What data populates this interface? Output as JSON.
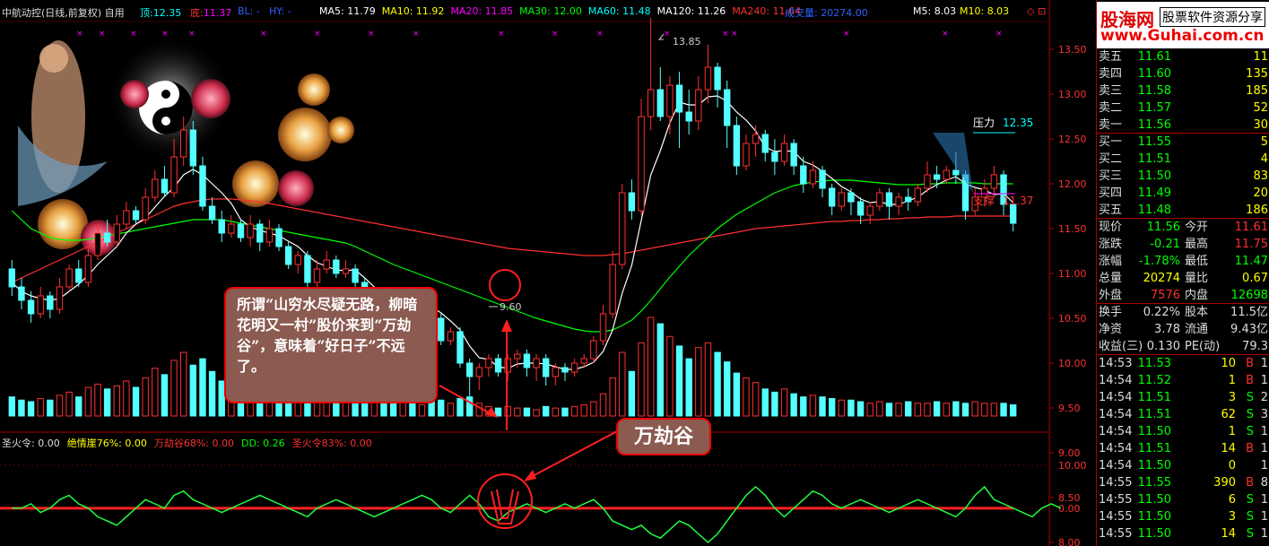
{
  "header": {
    "title": "中航动控(日线,前复权) 自用",
    "top_label": "顶:",
    "top_val": "12.35",
    "bot_label": "底:",
    "bot_val": "11.37",
    "bl": "BL: -",
    "hy": "HY: -",
    "ma": [
      {
        "label": "MA5: 11.79",
        "color": "#ffffff"
      },
      {
        "label": "MA10: 11.92",
        "color": "#ffff00"
      },
      {
        "label": "MA20: 11.85",
        "color": "#ff00ff"
      },
      {
        "label": "MA30: 12.00",
        "color": "#00ff00"
      },
      {
        "label": "MA60: 11.48",
        "color": "#00ffff"
      },
      {
        "label": "MA120: 11.26",
        "color": "#ffffff"
      },
      {
        "label": "MA240: 11.64",
        "color": "#ff3030"
      }
    ],
    "vol": "成交量: 20274.00",
    "m5": "M5: 8.03",
    "m10": "M10: 8.03"
  },
  "indicator_header": [
    {
      "label": "圣火令: 0.00",
      "color": "#dddddd"
    },
    {
      "label": "绝情崖76%: 0.00",
      "color": "#ffff00"
    },
    {
      "label": "万劫谷68%: 0.00",
      "color": "#ff3030"
    },
    {
      "label": "DD: 0.26",
      "color": "#00ff00"
    },
    {
      "label": "圣火令83%: 0.00",
      "color": "#ff3030"
    }
  ],
  "callout_text": "所谓“山穷水尽疑无路，柳暗花明又一村”股价来到“万劫谷”，意味着“好日子”不远了。",
  "badge_text": "万劫谷",
  "annotations": {
    "high": "13.85",
    "low": "9.60",
    "pressure": "压力",
    "pressure_val": "12.35",
    "support": "支撑",
    "support_val": "11.37"
  },
  "logo": {
    "line1": "股海网",
    "line2": "股票软件资源分享",
    "line3": "www.Guhai.com.cn"
  },
  "orderbook": [
    {
      "label": "卖五",
      "price": "11.61",
      "vol": "11"
    },
    {
      "label": "卖四",
      "price": "11.60",
      "vol": "135"
    },
    {
      "label": "卖三",
      "price": "11.58",
      "vol": "185"
    },
    {
      "label": "卖二",
      "price": "11.57",
      "vol": "52"
    },
    {
      "label": "卖一",
      "price": "11.56",
      "vol": "30"
    },
    {
      "label": "买一",
      "price": "11.55",
      "vol": "5"
    },
    {
      "label": "买二",
      "price": "11.51",
      "vol": "4"
    },
    {
      "label": "买三",
      "price": "11.50",
      "vol": "83"
    },
    {
      "label": "买四",
      "price": "11.49",
      "vol": "20"
    },
    {
      "label": "买五",
      "price": "11.48",
      "vol": "186"
    }
  ],
  "stats": [
    {
      "l1": "现价",
      "v1": "11.56",
      "c1": "#00ff00",
      "l2": "今开",
      "v2": "11.61",
      "c2": "#ff3030"
    },
    {
      "l1": "涨跌",
      "v1": "-0.21",
      "c1": "#00ff00",
      "l2": "最高",
      "v2": "11.75",
      "c2": "#ff3030"
    },
    {
      "l1": "涨幅",
      "v1": "-1.78%",
      "c1": "#00ff00",
      "l2": "最低",
      "v2": "11.47",
      "c2": "#00ff00"
    },
    {
      "l1": "总量",
      "v1": "20274",
      "c1": "#ffff00",
      "l2": "量比",
      "v2": "0.67",
      "c2": "#ffff00"
    },
    {
      "l1": "外盘",
      "v1": "7576",
      "c1": "#ff3030",
      "l2": "内盘",
      "v2": "12698",
      "c2": "#00ff00"
    }
  ],
  "stats2": [
    {
      "l1": "换手",
      "v1": "0.22%",
      "l2": "股本",
      "v2": "11.5亿"
    },
    {
      "l1": "净资",
      "v1": "3.78",
      "l2": "流通",
      "v2": "9.43亿"
    },
    {
      "l1": "收益(三)",
      "v1": "0.130",
      "l2": "PE(动)",
      "v2": "79.3"
    }
  ],
  "ticks": [
    {
      "t": "14:53",
      "p": "11.53",
      "v": "10",
      "s": "B",
      "n": "1"
    },
    {
      "t": "14:54",
      "p": "11.52",
      "v": "1",
      "s": "B",
      "n": "1"
    },
    {
      "t": "14:54",
      "p": "11.51",
      "v": "3",
      "s": "S",
      "n": "2"
    },
    {
      "t": "14:54",
      "p": "11.51",
      "v": "62",
      "s": "S",
      "n": "3"
    },
    {
      "t": "14:54",
      "p": "11.50",
      "v": "1",
      "s": "S",
      "n": "1"
    },
    {
      "t": "14:54",
      "p": "11.51",
      "v": "14",
      "s": "B",
      "n": "1"
    },
    {
      "t": "14:54",
      "p": "11.50",
      "v": "0",
      "s": "",
      "n": "1"
    },
    {
      "t": "14:55",
      "p": "11.55",
      "v": "390",
      "s": "B",
      "n": "8"
    },
    {
      "t": "14:55",
      "p": "11.50",
      "v": "6",
      "s": "S",
      "n": "1"
    },
    {
      "t": "14:55",
      "p": "11.50",
      "v": "3",
      "s": "S",
      "n": "1"
    },
    {
      "t": "14:55",
      "p": "11.50",
      "v": "14",
      "s": "S",
      "n": "1"
    }
  ],
  "chart_data": {
    "type": "candlestick",
    "y_axis_ticks": [
      "13.50",
      "13.00",
      "12.50",
      "12.00",
      "11.50",
      "11.00",
      "10.50",
      "10.00",
      "9.50",
      "9.00",
      "8.50",
      "8.00"
    ],
    "price_ylim": [
      9.25,
      13.75
    ],
    "indicator_ticks": [
      "10.00",
      "0.00"
    ],
    "indicator_ylim": [
      -8,
      14
    ],
    "candles": [
      [
        11.05,
        10.85,
        11.15,
        10.75
      ],
      [
        10.85,
        10.7,
        10.95,
        10.6
      ],
      [
        10.7,
        10.55,
        10.8,
        10.45
      ],
      [
        10.55,
        10.75,
        10.85,
        10.5
      ],
      [
        10.75,
        10.6,
        10.8,
        10.5
      ],
      [
        10.6,
        10.85,
        10.95,
        10.55
      ],
      [
        10.85,
        11.05,
        11.1,
        10.8
      ],
      [
        11.05,
        10.9,
        11.15,
        10.85
      ],
      [
        10.9,
        11.2,
        11.3,
        10.85
      ],
      [
        11.2,
        11.45,
        11.55,
        11.15
      ],
      [
        11.45,
        11.35,
        11.6,
        11.3
      ],
      [
        11.35,
        11.55,
        11.65,
        11.3
      ],
      [
        11.55,
        11.7,
        11.8,
        11.5
      ],
      [
        11.7,
        11.6,
        11.75,
        11.55
      ],
      [
        11.6,
        11.85,
        11.95,
        11.55
      ],
      [
        11.85,
        12.05,
        12.15,
        11.8
      ],
      [
        12.05,
        11.9,
        12.2,
        11.85
      ],
      [
        11.9,
        12.3,
        12.5,
        11.85
      ],
      [
        12.3,
        12.6,
        12.75,
        12.2
      ],
      [
        12.6,
        12.2,
        12.7,
        12.1
      ],
      [
        12.2,
        11.75,
        12.3,
        11.7
      ],
      [
        11.75,
        11.6,
        11.85,
        11.55
      ],
      [
        11.6,
        11.45,
        11.7,
        11.35
      ],
      [
        11.45,
        11.55,
        11.65,
        11.4
      ],
      [
        11.55,
        11.4,
        11.6,
        11.35
      ],
      [
        11.4,
        11.55,
        11.65,
        11.3
      ],
      [
        11.55,
        11.35,
        11.6,
        11.25
      ],
      [
        11.35,
        11.5,
        11.6,
        11.3
      ],
      [
        11.5,
        11.3,
        11.55,
        11.25
      ],
      [
        11.3,
        11.1,
        11.35,
        11.05
      ],
      [
        11.1,
        11.2,
        11.25,
        11.0
      ],
      [
        11.2,
        10.9,
        11.25,
        10.85
      ],
      [
        10.9,
        11.05,
        11.15,
        10.85
      ],
      [
        11.05,
        11.15,
        11.25,
        11.0
      ],
      [
        11.15,
        11.0,
        11.2,
        10.95
      ],
      [
        11.0,
        11.05,
        11.15,
        10.95
      ],
      [
        11.05,
        10.9,
        11.1,
        10.85
      ],
      [
        10.9,
        10.55,
        10.95,
        10.5
      ],
      [
        10.55,
        10.7,
        10.75,
        10.5
      ],
      [
        10.7,
        10.65,
        10.8,
        10.6
      ],
      [
        10.65,
        10.6,
        10.7,
        10.55
      ],
      [
        10.6,
        10.8,
        10.85,
        10.55
      ],
      [
        10.8,
        10.55,
        10.85,
        10.5
      ],
      [
        10.55,
        10.7,
        10.75,
        10.5
      ],
      [
        10.7,
        10.5,
        10.75,
        10.45
      ],
      [
        10.5,
        10.25,
        10.55,
        10.2
      ],
      [
        10.25,
        10.35,
        10.4,
        10.2
      ],
      [
        10.35,
        10.0,
        10.4,
        9.95
      ],
      [
        10.0,
        9.85,
        10.05,
        9.6
      ],
      [
        9.85,
        9.95,
        10.0,
        9.7
      ],
      [
        9.95,
        10.05,
        10.1,
        9.85
      ],
      [
        10.05,
        9.9,
        10.1,
        9.85
      ],
      [
        9.9,
        10.05,
        10.1,
        9.8
      ],
      [
        10.05,
        10.1,
        10.15,
        9.95
      ],
      [
        10.1,
        9.95,
        10.15,
        9.85
      ],
      [
        9.95,
        10.05,
        10.1,
        9.8
      ],
      [
        10.05,
        9.85,
        10.1,
        9.75
      ],
      [
        9.85,
        9.95,
        10.0,
        9.75
      ],
      [
        9.95,
        9.9,
        10.0,
        9.8
      ],
      [
        9.9,
        10.0,
        10.05,
        9.85
      ],
      [
        10.0,
        10.05,
        10.1,
        9.95
      ],
      [
        10.05,
        10.25,
        10.3,
        10.0
      ],
      [
        10.25,
        10.55,
        10.65,
        10.2
      ],
      [
        10.55,
        11.1,
        11.25,
        10.5
      ],
      [
        11.1,
        11.9,
        12.0,
        11.05
      ],
      [
        11.9,
        11.7,
        12.05,
        11.6
      ],
      [
        11.7,
        12.75,
        12.95,
        11.65
      ],
      [
        12.75,
        13.05,
        13.85,
        12.6
      ],
      [
        13.05,
        12.75,
        13.3,
        12.7
      ],
      [
        12.75,
        13.1,
        13.2,
        12.55
      ],
      [
        13.1,
        12.8,
        13.25,
        12.4
      ],
      [
        12.8,
        12.7,
        13.05,
        12.55
      ],
      [
        12.7,
        13.05,
        13.2,
        12.6
      ],
      [
        13.05,
        13.3,
        13.55,
        12.9
      ],
      [
        13.3,
        13.05,
        13.35,
        12.85
      ],
      [
        13.05,
        12.65,
        13.15,
        12.4
      ],
      [
        12.65,
        12.2,
        12.75,
        12.1
      ],
      [
        12.2,
        12.45,
        12.55,
        12.15
      ],
      [
        12.45,
        12.55,
        12.65,
        12.3
      ],
      [
        12.55,
        12.35,
        12.6,
        12.25
      ],
      [
        12.35,
        12.25,
        12.5,
        12.1
      ],
      [
        12.25,
        12.45,
        12.55,
        12.2
      ],
      [
        12.45,
        12.2,
        12.5,
        12.1
      ],
      [
        12.2,
        12.0,
        12.3,
        11.9
      ],
      [
        12.0,
        12.15,
        12.25,
        11.95
      ],
      [
        12.15,
        11.95,
        12.2,
        11.85
      ],
      [
        11.95,
        11.75,
        12.0,
        11.65
      ],
      [
        11.75,
        11.9,
        11.95,
        11.7
      ],
      [
        11.9,
        11.8,
        11.95,
        11.65
      ],
      [
        11.8,
        11.65,
        11.85,
        11.55
      ],
      [
        11.65,
        11.75,
        11.8,
        11.55
      ],
      [
        11.75,
        11.9,
        11.95,
        11.7
      ],
      [
        11.9,
        11.75,
        11.95,
        11.6
      ],
      [
        11.75,
        11.85,
        11.9,
        11.65
      ],
      [
        11.85,
        11.8,
        11.95,
        11.7
      ],
      [
        11.8,
        11.95,
        12.0,
        11.75
      ],
      [
        11.95,
        12.1,
        12.25,
        11.9
      ],
      [
        12.1,
        12.05,
        12.2,
        11.95
      ],
      [
        12.05,
        12.15,
        12.2,
        12.0
      ],
      [
        12.15,
        12.1,
        12.35,
        12.0
      ],
      [
        12.1,
        11.7,
        12.15,
        11.6
      ],
      [
        11.7,
        11.85,
        11.95,
        11.65
      ],
      [
        11.85,
        11.95,
        12.05,
        11.75
      ],
      [
        11.95,
        12.1,
        12.2,
        11.85
      ],
      [
        12.1,
        11.77,
        12.15,
        11.65
      ],
      [
        11.77,
        11.56,
        11.75,
        11.47
      ]
    ],
    "ma5": [
      10.9,
      10.8,
      10.75,
      10.72,
      10.7,
      10.72,
      10.8,
      10.88,
      10.98,
      11.1,
      11.2,
      11.3,
      11.45,
      11.55,
      11.62,
      11.74,
      11.86,
      11.96,
      12.1,
      12.16,
      12.1,
      12.0,
      11.9,
      11.78,
      11.6,
      11.52,
      11.48,
      11.45,
      11.42,
      11.36,
      11.3,
      11.2,
      11.12,
      11.08,
      11.04,
      11.03,
      11.04,
      10.95,
      10.85,
      10.76,
      10.7,
      10.66,
      10.66,
      10.66,
      10.63,
      10.56,
      10.47,
      10.37,
      10.19,
      10.06,
      10.04,
      9.96,
      9.94,
      9.99,
      10.0,
      10.0,
      9.99,
      9.96,
      9.93,
      9.93,
      9.96,
      10.01,
      10.13,
      10.37,
      10.78,
      11.09,
      11.59,
      12.1,
      12.37,
      12.68,
      12.91,
      12.88,
      12.88,
      12.97,
      12.98,
      12.92,
      12.8,
      12.71,
      12.59,
      12.41,
      12.36,
      12.37,
      12.36,
      12.25,
      12.21,
      12.14,
      12.06,
      11.97,
      11.91,
      11.83,
      11.79,
      11.8,
      11.77,
      11.77,
      11.81,
      11.85,
      11.93,
      11.99,
      12.04,
      12.08,
      12.0,
      11.96,
      11.93,
      11.88,
      11.89,
      11.79
    ],
    "ma30": [
      11.7,
      11.6,
      11.5,
      11.45,
      11.4,
      11.38,
      11.37,
      11.37,
      11.38,
      11.4,
      11.42,
      11.44,
      11.46,
      11.48,
      11.5,
      11.52,
      11.54,
      11.56,
      11.58,
      11.6,
      11.6,
      11.6,
      11.6,
      11.58,
      11.56,
      11.54,
      11.52,
      11.5,
      11.48,
      11.46,
      11.44,
      11.42,
      11.4,
      11.38,
      11.36,
      11.34,
      11.3,
      11.25,
      11.2,
      11.15,
      11.1,
      11.06,
      11.02,
      10.98,
      10.94,
      10.9,
      10.86,
      10.82,
      10.78,
      10.74,
      10.7,
      10.66,
      10.62,
      10.58,
      10.54,
      10.5,
      10.47,
      10.44,
      10.41,
      10.38,
      10.36,
      10.35,
      10.35,
      10.37,
      10.42,
      10.48,
      10.58,
      10.7,
      10.83,
      10.96,
      11.08,
      11.2,
      11.3,
      11.4,
      11.5,
      11.58,
      11.66,
      11.72,
      11.78,
      11.84,
      11.9,
      11.94,
      11.98,
      12.0,
      12.02,
      12.03,
      12.04,
      12.04,
      12.04,
      12.03,
      12.02,
      12.01,
      12.0,
      11.99,
      11.99,
      11.99,
      12.0,
      12.0,
      12.01,
      12.01,
      12.01,
      12.01,
      12.0,
      12.0,
      12.0,
      12.0
    ],
    "ma240": [
      10.9,
      10.95,
      11.0,
      11.05,
      11.1,
      11.15,
      11.2,
      11.25,
      11.3,
      11.35,
      11.4,
      11.45,
      11.5,
      11.55,
      11.6,
      11.65,
      11.7,
      11.75,
      11.78,
      11.8,
      11.82,
      11.83,
      11.83,
      11.83,
      11.82,
      11.81,
      11.8,
      11.78,
      11.76,
      11.74,
      11.72,
      11.7,
      11.68,
      11.66,
      11.64,
      11.62,
      11.6,
      11.58,
      11.56,
      11.54,
      11.52,
      11.5,
      11.48,
      11.46,
      11.44,
      11.42,
      11.4,
      11.38,
      11.36,
      11.34,
      11.32,
      11.3,
      11.28,
      11.27,
      11.26,
      11.25,
      11.24,
      11.23,
      11.22,
      11.21,
      11.2,
      11.2,
      11.2,
      11.21,
      11.22,
      11.24,
      11.26,
      11.28,
      11.3,
      11.32,
      11.34,
      11.36,
      11.38,
      11.4,
      11.42,
      11.44,
      11.46,
      11.48,
      11.5,
      11.51,
      11.52,
      11.53,
      11.54,
      11.55,
      11.56,
      11.57,
      11.58,
      11.58,
      11.59,
      11.59,
      11.6,
      11.6,
      11.61,
      11.61,
      11.62,
      11.62,
      11.63,
      11.63,
      11.63,
      11.64,
      11.64,
      11.64,
      11.64,
      11.64,
      11.64,
      11.64
    ],
    "volumes": [
      1.2,
      1.0,
      0.9,
      1.1,
      1.0,
      1.3,
      1.5,
      1.2,
      1.8,
      2.0,
      1.7,
      1.9,
      2.2,
      1.8,
      2.4,
      3.0,
      2.6,
      3.5,
      4.0,
      3.2,
      3.6,
      2.8,
      2.2,
      1.9,
      2.1,
      2.4,
      2.6,
      2.0,
      1.7,
      1.5,
      1.8,
      1.4,
      1.2,
      1.3,
      1.1,
      1.2,
      1.0,
      1.5,
      1.1,
      0.9,
      0.8,
      0.9,
      0.8,
      0.7,
      0.9,
      1.0,
      0.8,
      1.1,
      1.2,
      0.8,
      0.6,
      0.5,
      0.6,
      0.5,
      0.5,
      0.4,
      0.6,
      0.5,
      0.5,
      0.6,
      0.7,
      0.9,
      1.4,
      2.4,
      4.0,
      2.8,
      4.6,
      6.2,
      5.8,
      5.0,
      4.4,
      3.6,
      4.3,
      4.6,
      4.0,
      3.4,
      2.7,
      2.4,
      2.1,
      1.7,
      1.5,
      1.7,
      1.4,
      1.2,
      1.3,
      1.2,
      1.1,
      1.0,
      1.0,
      0.9,
      0.8,
      0.9,
      0.8,
      0.8,
      0.9,
      0.8,
      0.8,
      0.9,
      0.8,
      0.9,
      0.8,
      0.9,
      0.8,
      0.8,
      0.8,
      0.7
    ],
    "indicator_dd": [
      0,
      0,
      1,
      -1,
      0,
      2,
      3,
      1,
      0,
      -2,
      -3,
      -4,
      -2,
      0,
      2,
      1,
      0,
      3,
      4,
      2,
      1,
      0,
      -1,
      0,
      1,
      2,
      3,
      2,
      1,
      0,
      -1,
      -2,
      0,
      1,
      2,
      1,
      0,
      -1,
      -2,
      -1,
      0,
      1,
      2,
      3,
      2,
      0,
      -1,
      1,
      3,
      1,
      -2,
      -3,
      -1,
      0,
      1,
      0,
      -1,
      0,
      1,
      0,
      1,
      2,
      0,
      -3,
      -4,
      -5,
      -4,
      -6,
      -7,
      -5,
      -3,
      -4,
      -6,
      -8,
      -6,
      -3,
      0,
      3,
      5,
      3,
      0,
      -2,
      0,
      2,
      4,
      3,
      1,
      0,
      1,
      2,
      1,
      0,
      -1,
      0,
      1,
      2,
      1,
      0,
      -1,
      -2,
      0,
      3,
      5,
      2,
      1,
      0,
      -1,
      -2,
      0,
      1,
      0
    ]
  }
}
